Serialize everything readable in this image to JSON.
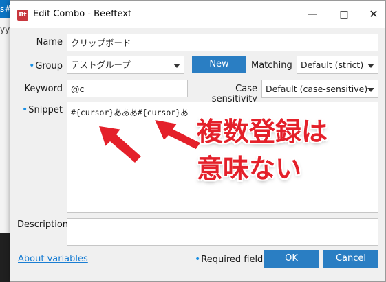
{
  "background": {
    "fragment_top": "s#",
    "fragment_mid": "yy"
  },
  "window": {
    "title": "Edit Combo - Beeftext",
    "app_icon": "Bt",
    "minimize_glyph": "—",
    "maximize_glyph": "□",
    "close_glyph": "✕"
  },
  "form": {
    "name_label": "Name",
    "name_value": "クリップボード",
    "group_label": "Group",
    "group_value": "テストグループ",
    "new_button": "New",
    "matching_label": "Matching",
    "matching_value": "Default (strict)",
    "keyword_label": "Keyword",
    "keyword_value": "@c",
    "case_label": "Case sensitivity",
    "case_value": "Default (case-sensitive)",
    "snippet_label": "Snippet",
    "snippet_value": "#{cursor}あああ#{cursor}あ",
    "description_label": "Description",
    "description_value": ""
  },
  "footer": {
    "about_link": "About variables",
    "required_note": "Required fields",
    "ok_button": "OK",
    "cancel_button": "Cancel"
  },
  "annotation": {
    "line1": "複数登録は",
    "line2": "意味ない"
  },
  "colors": {
    "accent": "#2a7ec3",
    "required_marker": "#1a8fe3",
    "annotation": "#e4202a"
  }
}
